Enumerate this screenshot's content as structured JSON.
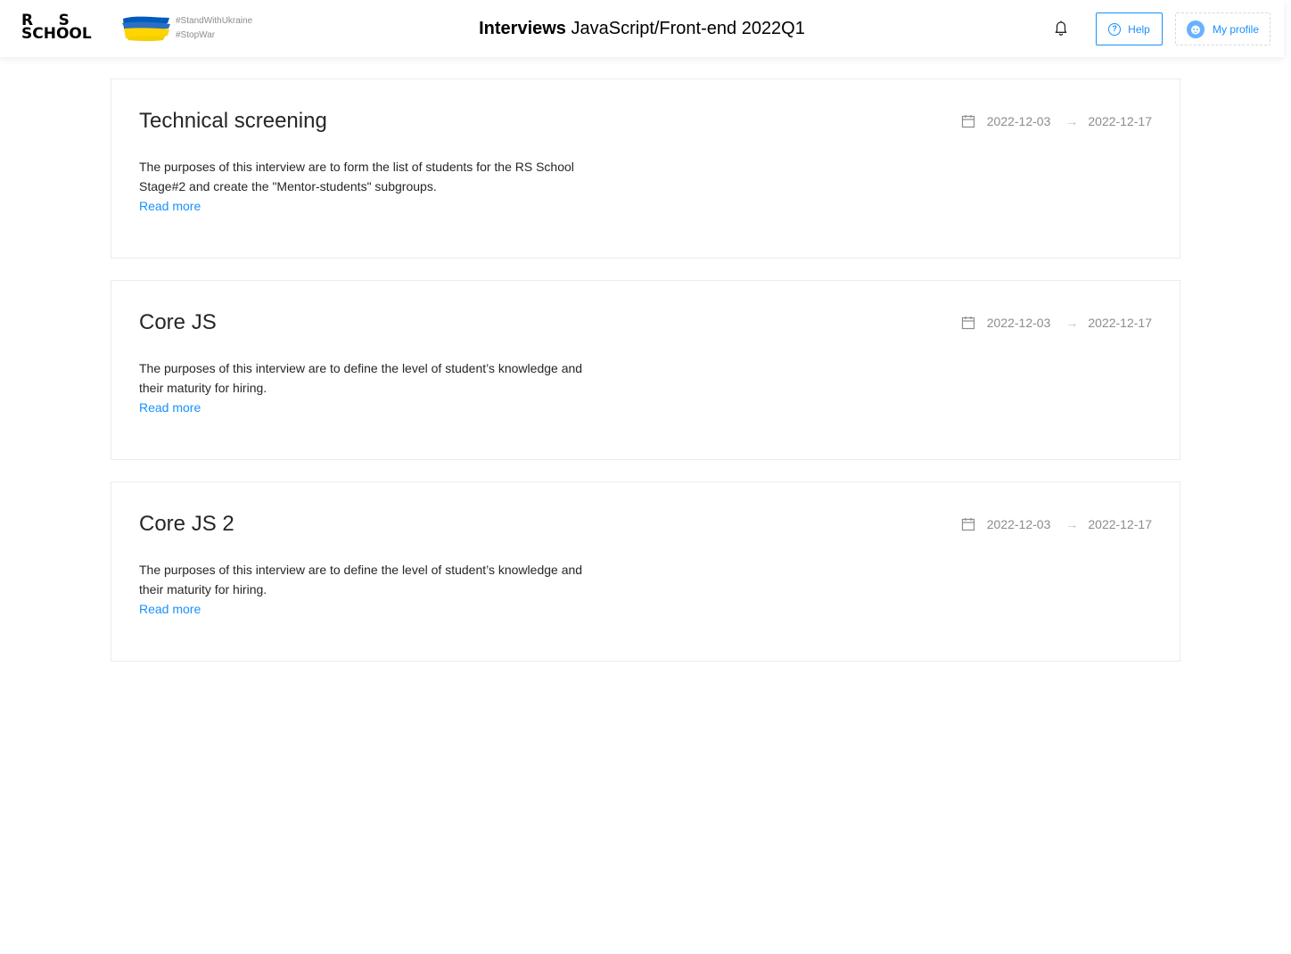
{
  "header": {
    "logo_line1_left": "R",
    "logo_line1_right": "S",
    "logo_line2": "SCHOOL",
    "hashtag1": "#StandWithUkraine",
    "hashtag2": "#StopWar",
    "title_strong": "Interviews",
    "title_rest": "JavaScript/Front-end 2022Q1",
    "help_label": "Help",
    "profile_label": "My profile",
    "icons": [
      "bell-icon",
      "question-circle-icon",
      "avatar-icon",
      "ukraine-flag-icon"
    ]
  },
  "colors": {
    "accent": "#1890ff",
    "flag_blue": "#005bbb",
    "flag_yellow": "#ffd500"
  },
  "interviews": [
    {
      "title": "Technical screening",
      "start": "2022-12-03",
      "end": "2022-12-17",
      "description": "The purposes of this interview are to form the list of students for the RS School Stage#2 and create the \"Mentor-students\" subgroups.",
      "link": "Read more"
    },
    {
      "title": "Core JS",
      "start": "2022-12-03",
      "end": "2022-12-17",
      "description": "The purposes of this interview are to define the level of student’s knowledge  and their maturity for hiring.",
      "link": "Read more"
    },
    {
      "title": "Core JS 2",
      "start": "2022-12-03",
      "end": "2022-12-17",
      "description": "The purposes of this interview are to define the level of student’s knowledge  and their maturity for hiring.",
      "link": "Read more"
    }
  ]
}
